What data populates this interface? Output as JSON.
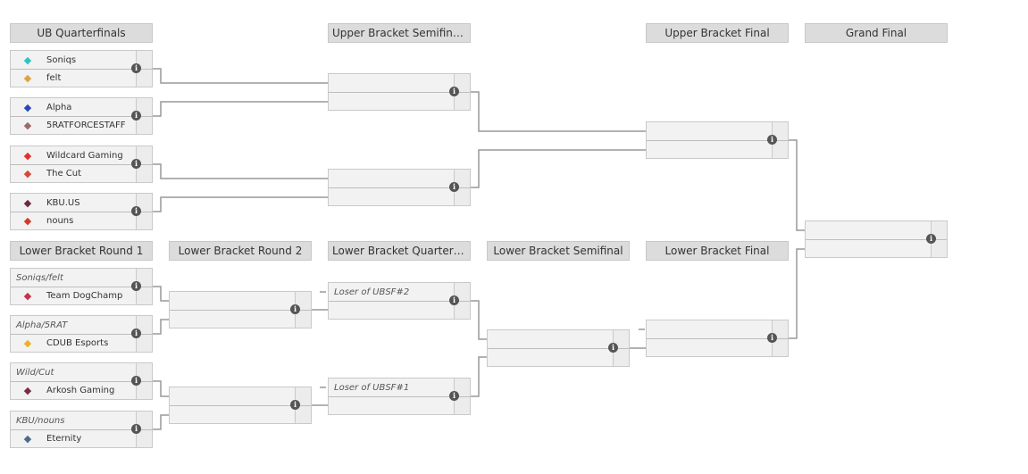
{
  "headers": {
    "ubqf": "UB Quarterfinals",
    "ubsf": "Upper Bracket Semifinals",
    "ubf": "Upper Bracket Final",
    "gf": "Grand Final",
    "lbr1": "Lower Bracket Round 1",
    "lbr2": "Lower Bracket Round 2",
    "lbqf": "Lower Bracket Quarterfinals",
    "lbsf": "Lower Bracket Semifinal",
    "lbf": "Lower Bracket Final"
  },
  "matches": {
    "ubqf1": [
      {
        "name": "Soniqs",
        "logo": "soniqs-logo",
        "color": "#2ec4c4"
      },
      {
        "name": "felt",
        "logo": "felt-logo",
        "color": "#d9a441"
      }
    ],
    "ubqf2": [
      {
        "name": "Alpha",
        "logo": "alpha-logo",
        "color": "#2a47b8"
      },
      {
        "name": "5RATFORCESTAFF",
        "logo": "5rat-logo",
        "color": "#9a6b6b"
      }
    ],
    "ubqf3": [
      {
        "name": "Wildcard Gaming",
        "logo": "wildcard-logo",
        "color": "#e0322d"
      },
      {
        "name": "The Cut",
        "logo": "thecut-logo",
        "color": "#d44a3a"
      }
    ],
    "ubqf4": [
      {
        "name": "KBU.US",
        "logo": "kbu-logo",
        "color": "#6b2d3c"
      },
      {
        "name": "nouns",
        "logo": "nouns-logo",
        "color": "#d43a2a"
      }
    ],
    "ubsf1": [
      {},
      {}
    ],
    "ubsf2": [
      {},
      {}
    ],
    "ubf": [
      {},
      {}
    ],
    "gf": [
      {},
      {}
    ],
    "lbr1a": [
      {
        "placeholder": "Soniqs/felt"
      },
      {
        "name": "Team DogChamp",
        "logo": "dogchamp-logo",
        "color": "#c8324a"
      }
    ],
    "lbr1b": [
      {
        "placeholder": "Alpha/5RAT"
      },
      {
        "name": "CDUB Esports",
        "logo": "cdub-logo",
        "color": "#f0b020"
      }
    ],
    "lbr1c": [
      {
        "placeholder": "Wild/Cut"
      },
      {
        "name": "Arkosh Gaming",
        "logo": "arkosh-logo",
        "color": "#7a2a4a"
      }
    ],
    "lbr1d": [
      {
        "placeholder": "KBU/nouns"
      },
      {
        "name": "Eternity",
        "logo": "eternity-logo",
        "color": "#4a6a8a"
      }
    ],
    "lbr2a": [
      {},
      {}
    ],
    "lbr2b": [
      {},
      {}
    ],
    "lbqf1": [
      {
        "placeholder": "Loser of UBSF#2"
      },
      {}
    ],
    "lbqf2": [
      {
        "placeholder": "Loser of UBSF#1"
      },
      {}
    ],
    "lbsf": [
      {},
      {}
    ],
    "lbf": [
      {},
      {}
    ]
  },
  "info_icon": "i"
}
